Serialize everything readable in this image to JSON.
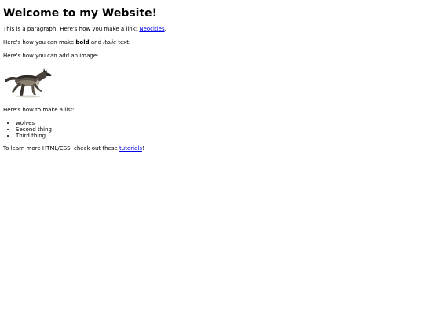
{
  "heading": "Welcome to my Website!",
  "para1": {
    "text": "This is a paragraph! Here's how you make a link: ",
    "link": "Neocities",
    "end": "."
  },
  "para2": {
    "before": "Here's how you can make ",
    "bold": "bold",
    "mid": " and ",
    "italic": "italic",
    "after": " text."
  },
  "para3": "Here's how you can add an image:",
  "image": {
    "icon": "wolf-image"
  },
  "para4": "Here's how to make a list:",
  "list": [
    "wolves",
    "Second thing",
    "Third thing"
  ],
  "para5": {
    "before": "To learn more HTML/CSS, check out these ",
    "link": "tutorials",
    "after": "!"
  },
  "colors": {
    "link": "#0000ee",
    "text": "#000000",
    "background": "#ffffff"
  }
}
